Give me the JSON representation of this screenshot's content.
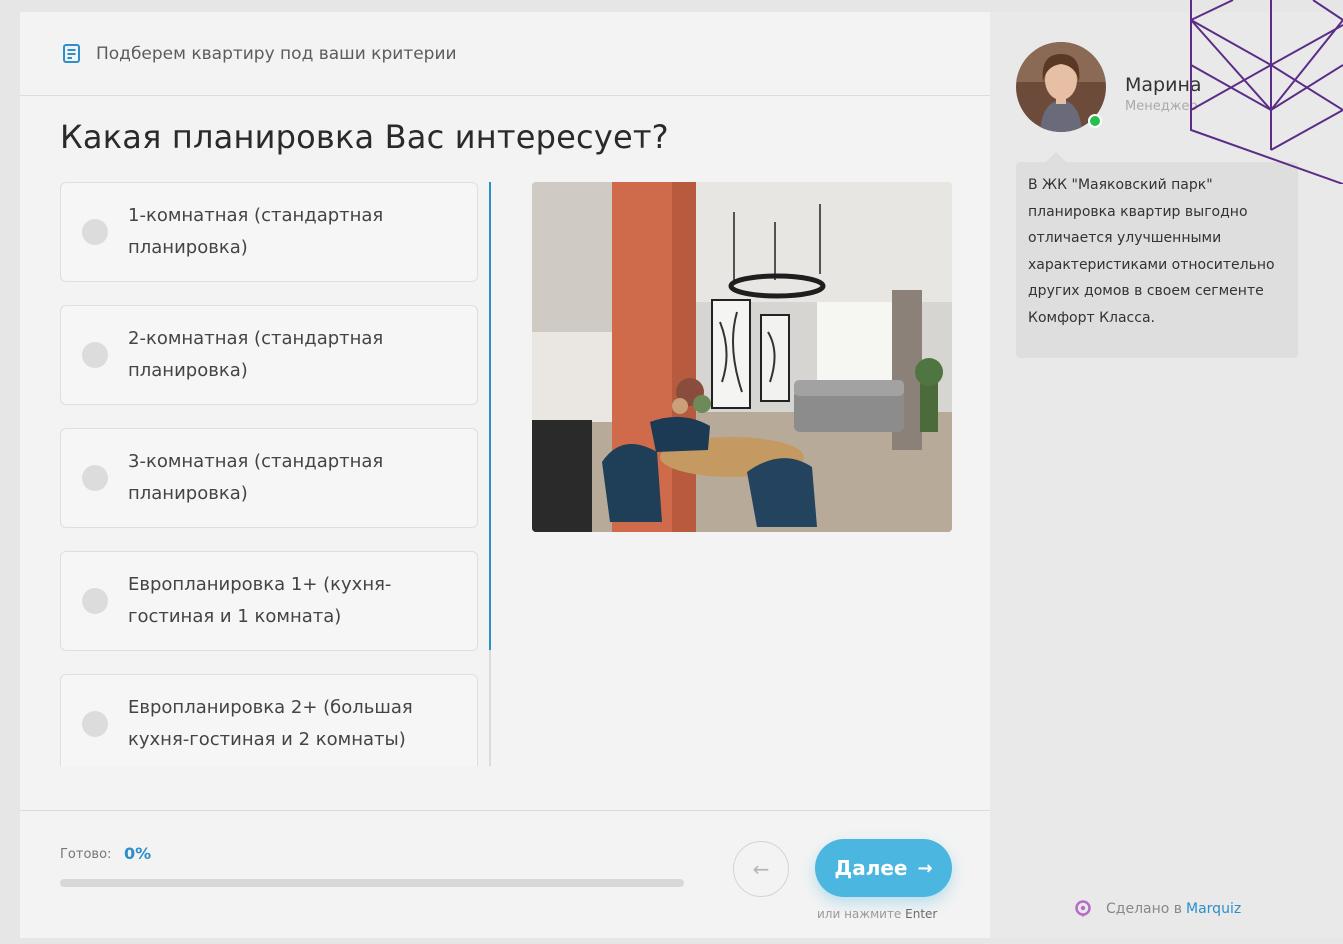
{
  "header": {
    "title": "Подберем квартиру под ваши критерии",
    "icon": "form-list-icon"
  },
  "question": {
    "title": "Какая планировка Вас интересует?"
  },
  "options": [
    {
      "label": "1-комнатная (стандартная планировка)",
      "selected": false
    },
    {
      "label": "2-комнатная (стандартная планировка)",
      "selected": false
    },
    {
      "label": "3-комнатная (стандартная планировка)",
      "selected": false
    },
    {
      "label": "Европланировка 1+ (кухня-гостиная и 1 комната)",
      "selected": false
    },
    {
      "label": "Европланировка 2+ (большая кухня-гостиная и 2 комнаты)",
      "selected": false
    }
  ],
  "footer": {
    "progress_label": "Готово:",
    "progress_value": "0%",
    "progress_fraction": 0,
    "back_icon": "arrow-left-icon",
    "next_label": "Далее",
    "next_icon": "arrow-right-icon",
    "hint_prefix": "или нажмите",
    "hint_key": "Enter"
  },
  "manager": {
    "name": "Марина",
    "role": "Менеджер",
    "status": "online",
    "message": "В ЖК \"Маяковский парк\" планировка квартир выгодно отличается улучшенными характеристиками относительно других домов в своем сегменте Комфорт Класса."
  },
  "branding": {
    "made_in": "Сделано в",
    "brand": "Marquiz"
  },
  "colors": {
    "accent": "#2b8fc9",
    "button": "#4bb6df",
    "online": "#27c04c",
    "deco": "#5b2d86"
  }
}
